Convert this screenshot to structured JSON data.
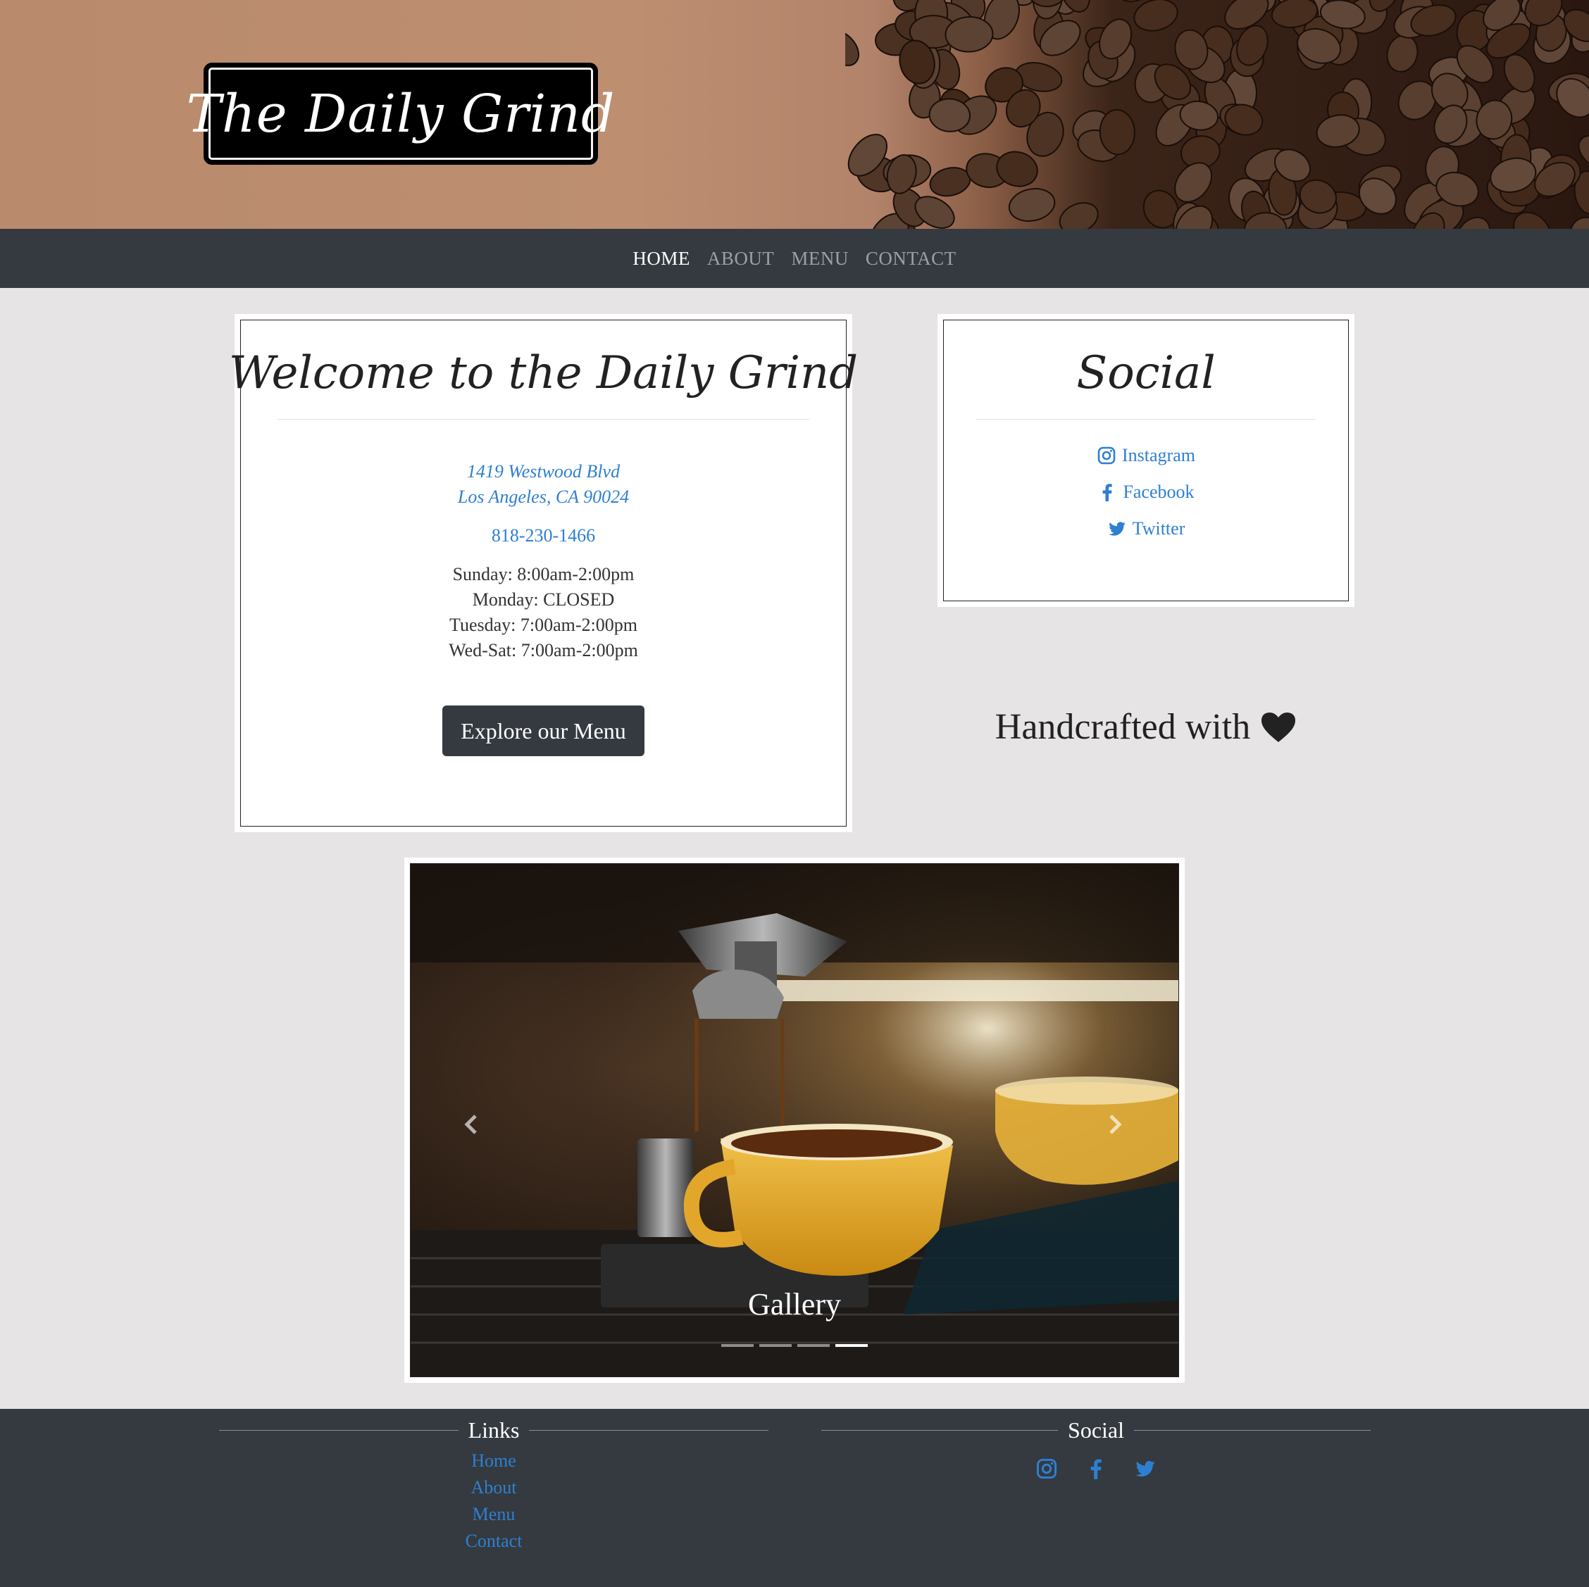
{
  "brand": {
    "logo_text": "The Daily Grind"
  },
  "nav": {
    "items": [
      {
        "label": "HOME",
        "active": true
      },
      {
        "label": "ABOUT",
        "active": false
      },
      {
        "label": "MENU",
        "active": false
      },
      {
        "label": "CONTACT",
        "active": false
      }
    ]
  },
  "welcome": {
    "title": "Welcome to the Daily Grind",
    "address_line1": "1419 Westwood Blvd",
    "address_line2": "Los Angeles, CA 90024",
    "phone": "818-230-1466",
    "hours": [
      "Sunday: 8:00am-2:00pm",
      "Monday: CLOSED",
      "Tuesday: 7:00am-2:00pm",
      "Wed-Sat: 7:00am-2:00pm"
    ],
    "cta_label": "Explore our Menu"
  },
  "social_card": {
    "title": "Social",
    "links": [
      {
        "label": "Instagram",
        "icon": "instagram-icon"
      },
      {
        "label": "Facebook",
        "icon": "facebook-icon"
      },
      {
        "label": "Twitter",
        "icon": "twitter-icon"
      }
    ]
  },
  "tagline": {
    "text": "Handcrafted with",
    "icon": "heart-icon"
  },
  "gallery": {
    "caption": "Gallery",
    "slide_count": 4,
    "active_slide": 4
  },
  "footer": {
    "links_heading": "Links",
    "links": [
      "Home",
      "About",
      "Menu",
      "Contact"
    ],
    "social_heading": "Social",
    "social_icons": [
      "instagram-icon",
      "facebook-icon",
      "twitter-icon"
    ]
  },
  "colors": {
    "dark": "#343a40",
    "link": "#2f7fd1",
    "page_bg": "#e6e4e5"
  }
}
